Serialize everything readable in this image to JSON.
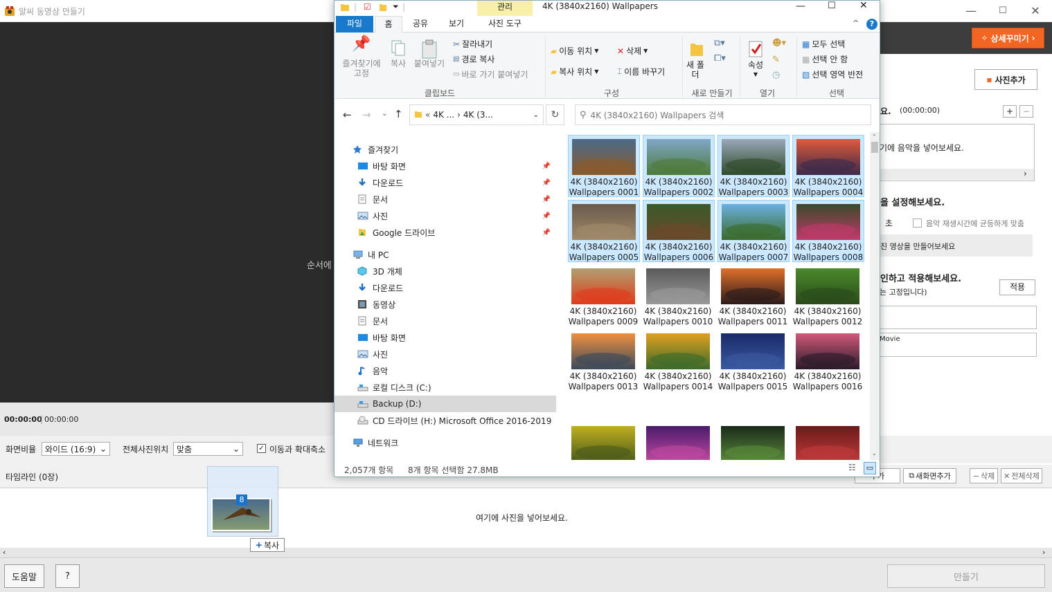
{
  "app": {
    "title": "알씨 동영상 만들기",
    "preview_hint": "순서에",
    "detail_button": "상세꾸미기",
    "add_photo_button": "사진추가",
    "time_current": "00:00:00",
    "time_total": "00:00:00",
    "aspect_label": "화면비율",
    "aspect_value": "와이드 (16:9)",
    "position_label": "전체사진위치",
    "position_value": "맞춤",
    "zoom_label": "이동과 확대축소",
    "timeline_label": "타임라인 (0장)",
    "timeline_hint": "여기에 사진을 넣어보세요.",
    "help_button": "도움말",
    "question_button": "?",
    "make_button": "만들기",
    "tl_btn1": "추가",
    "tl_btn2": "새화면추가",
    "tl_btn3": "삭제",
    "tl_btn4": "전체삭제",
    "drag_count": "8",
    "copy_tip": "복사"
  },
  "right_panel": {
    "music_heading": "요.",
    "music_time": "(00:00:00)",
    "music_hint": "기에 음악을 넣어보세요.",
    "time_heading": "을 설정해보세요.",
    "sec_label": "초",
    "music_fit_label": "음악 재생시간에 균등하게 맞춤",
    "make_hint": "진 영상을 만들어보세요",
    "apply_heading": "인하고 적용해보세요.",
    "apply_button": "적용",
    "fixed_note": "는 고정입니다)",
    "movie_field": "Movie"
  },
  "explorer": {
    "title": "4K (3840x2160) Wallpapers",
    "manage_tab": "관리",
    "tabs": [
      "파일",
      "홈",
      "공유",
      "보기",
      "사진 도구"
    ],
    "ribbon": {
      "pin": "즐겨찾기에 고정",
      "copy": "복사",
      "paste": "붙여넣기",
      "cut": "잘라내기",
      "copy_path": "경로 복사",
      "paste_shortcut": "바로 가기 붙여넣기",
      "group_clipboard": "클립보드",
      "move_to": "이동 위치",
      "copy_to": "복사 위치",
      "delete": "삭제",
      "rename": "이름 바꾸기",
      "group_organize": "구성",
      "new_folder": "새 폴더",
      "group_new": "새로 만들기",
      "properties": "속성",
      "group_open": "열기",
      "select_all": "모두 선택",
      "select_none": "선택 안 함",
      "invert_selection": "선택 영역 반전",
      "group_select": "선택"
    },
    "address": [
      "«",
      "4K ...",
      "›",
      "4K (3..."
    ],
    "search_placeholder": "4K (3840x2160) Wallpapers 검색",
    "nav": [
      {
        "label": "즐겨찾기",
        "indent": 1,
        "icon": "star-icon",
        "pin": false
      },
      {
        "label": "바탕 화면",
        "indent": 2,
        "icon": "desktop-icon",
        "pin": true
      },
      {
        "label": "다운로드",
        "indent": 2,
        "icon": "download-icon",
        "pin": true
      },
      {
        "label": "문서",
        "indent": 2,
        "icon": "document-icon",
        "pin": true
      },
      {
        "label": "사진",
        "indent": 2,
        "icon": "picture-icon",
        "pin": true
      },
      {
        "label": "Google 드라이브",
        "indent": 2,
        "icon": "google-drive-icon",
        "pin": true
      },
      {
        "label": "내 PC",
        "indent": 1,
        "icon": "pc-icon",
        "pin": false
      },
      {
        "label": "3D 개체",
        "indent": 2,
        "icon": "cube-icon",
        "pin": false
      },
      {
        "label": "다운로드",
        "indent": 2,
        "icon": "download-icon",
        "pin": false
      },
      {
        "label": "동영상",
        "indent": 2,
        "icon": "video-icon",
        "pin": false
      },
      {
        "label": "문서",
        "indent": 2,
        "icon": "document-icon",
        "pin": false
      },
      {
        "label": "바탕 화면",
        "indent": 2,
        "icon": "desktop-icon",
        "pin": false
      },
      {
        "label": "사진",
        "indent": 2,
        "icon": "picture-icon",
        "pin": false
      },
      {
        "label": "음악",
        "indent": 2,
        "icon": "music-icon",
        "pin": false
      },
      {
        "label": "로컬 디스크 (C:)",
        "indent": 2,
        "icon": "disk-icon",
        "pin": false
      },
      {
        "label": "Backup (D:)",
        "indent": 2,
        "icon": "disk-icon",
        "pin": false,
        "selected": true
      },
      {
        "label": "CD 드라이브 (H:) Microsoft Office 2016-2019",
        "indent": 2,
        "icon": "cd-icon",
        "pin": false
      },
      {
        "label": "네트워크",
        "indent": 1,
        "icon": "network-icon",
        "pin": false
      }
    ],
    "files": [
      {
        "line1": "4K (3840x2160)",
        "line2": "Wallpapers 0001",
        "selected": true,
        "c1": "#4a6a8a",
        "c2": "#8a5a2a"
      },
      {
        "line1": "4K (3840x2160)",
        "line2": "Wallpapers 0002",
        "selected": true,
        "c1": "#7fa7c8",
        "c2": "#4d7a3a"
      },
      {
        "line1": "4K (3840x2160)",
        "line2": "Wallpapers 0003",
        "selected": true,
        "c1": "#9aa8b8",
        "c2": "#2f4a2a"
      },
      {
        "line1": "4K (3840x2160)",
        "line2": "Wallpapers 0004",
        "selected": true,
        "c1": "#e05a3a",
        "c2": "#3a2a4a"
      },
      {
        "line1": "4K (3840x2160)",
        "line2": "Wallpapers 0005",
        "selected": true,
        "c1": "#6a5a4a",
        "c2": "#a08a6a"
      },
      {
        "line1": "4K (3840x2160)",
        "line2": "Wallpapers 0006",
        "selected": true,
        "c1": "#3a5a2a",
        "c2": "#6a4a2a"
      },
      {
        "line1": "4K (3840x2160)",
        "line2": "Wallpapers 0007",
        "selected": true,
        "c1": "#6ab0e0",
        "c2": "#3a6a2a"
      },
      {
        "line1": "4K (3840x2160)",
        "line2": "Wallpapers 0008",
        "selected": true,
        "c1": "#3a4a2a",
        "c2": "#c03a6a"
      },
      {
        "line1": "4K (3840x2160)",
        "line2": "Wallpapers 0009",
        "selected": false,
        "c1": "#b0a070",
        "c2": "#e03a1a"
      },
      {
        "line1": "4K (3840x2160)",
        "line2": "Wallpapers 0010",
        "selected": false,
        "c1": "#5a5a5a",
        "c2": "#9a9a9a"
      },
      {
        "line1": "4K (3840x2160)",
        "line2": "Wallpapers 0011",
        "selected": false,
        "c1": "#e0702a",
        "c2": "#2a1a1a"
      },
      {
        "line1": "4K (3840x2160)",
        "line2": "Wallpapers 0012",
        "selected": false,
        "c1": "#4a8a2a",
        "c2": "#2a4a1a"
      },
      {
        "line1": "4K (3840x2160)",
        "line2": "Wallpapers 0013",
        "selected": false,
        "c1": "#f09040",
        "c2": "#3a4a5a"
      },
      {
        "line1": "4K (3840x2160)",
        "line2": "Wallpapers 0014",
        "selected": false,
        "c1": "#e0a020",
        "c2": "#3a6a2a"
      },
      {
        "line1": "4K (3840x2160)",
        "line2": "Wallpapers 0015",
        "selected": false,
        "c1": "#1a2a6a",
        "c2": "#3a5aa0"
      },
      {
        "line1": "4K (3840x2160)",
        "line2": "Wallpapers 0016",
        "selected": false,
        "c1": "#d05a7a",
        "c2": "#2a1a2a"
      },
      {
        "line1": "",
        "line2": "",
        "selected": false,
        "c1": "#c0b020",
        "c2": "#4a5a1a"
      },
      {
        "line1": "",
        "line2": "",
        "selected": false,
        "c1": "#4a1a6a",
        "c2": "#c04aa0"
      },
      {
        "line1": "",
        "line2": "",
        "selected": false,
        "c1": "#1a2a1a",
        "c2": "#5a8a3a"
      },
      {
        "line1": "",
        "line2": "",
        "selected": false,
        "c1": "#6a1a1a",
        "c2": "#c03a3a"
      }
    ],
    "status_count": "2,057개 항목",
    "status_selected": "8개 항목 선택함 27.8MB"
  },
  "colors": {
    "accent_orange": "#f26522",
    "explorer_blue": "#1979ca",
    "selection_blue": "#cce8ff"
  }
}
